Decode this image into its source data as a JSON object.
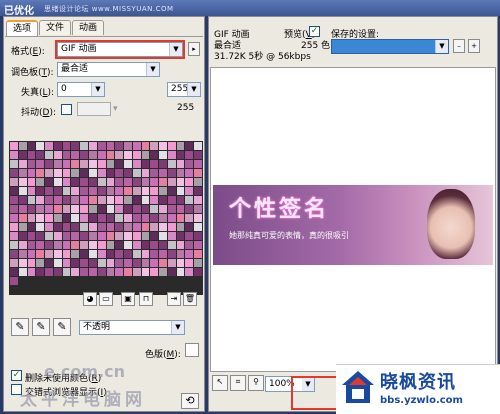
{
  "window": {
    "title": "已优化",
    "watermark_text": "思绪设计论坛 www.MISSYUAN.COM"
  },
  "left": {
    "tabs": [
      "选项",
      "文件",
      "动画"
    ],
    "format_label": "格式",
    "format_key": "E",
    "format_value": "GIF 动画",
    "palette_label": "调色板",
    "palette_key": "T",
    "palette_value": "最合适",
    "loss_label": "失真",
    "loss_key": "L",
    "loss_value": "0",
    "colors_value": "255",
    "colors_display": "255",
    "dither_label": "抖动",
    "dither_key": "D",
    "transparency_value": "不透明",
    "matte_label": "色版",
    "matte_key": "M",
    "remove_unused_label": "删除未使用颜色",
    "remove_unused_key": "R",
    "interlaced_label": "交错式浏览器显示",
    "interlaced_key": "I",
    "palette_icon_buttons": [
      "color-wheel-icon",
      "image-icon",
      "cube-icon",
      "lock-icon",
      "import-icon",
      "trash-icon"
    ],
    "eyedropper_buttons": [
      "eyedropper-icon",
      "eyedropper-plus-icon",
      "eyedropper-minus-icon"
    ]
  },
  "right": {
    "file_type": "GIF 动画",
    "palette": "最合适",
    "stats": "31.72K  5秒 @ 56kbps",
    "preview_label": "预览",
    "preview_key": "V",
    "colors_count": "255 色",
    "saved_settings_label": "保存的设置:",
    "banner_title": "个性签名",
    "banner_caption": "她那纯真可爱的表情，真的很吸引",
    "zoom_value": "100%"
  },
  "logo": {
    "name": "晓枫资讯",
    "url": "bbs.yzwlo.com"
  },
  "bottom_watermark": {
    "line1": "e.com.cn",
    "line2": "太平洋电脑网"
  },
  "colors": {
    "accent_blue": "#3c5592",
    "red_highlight": "#e23a2a",
    "palette_base": "#c87ab6"
  }
}
